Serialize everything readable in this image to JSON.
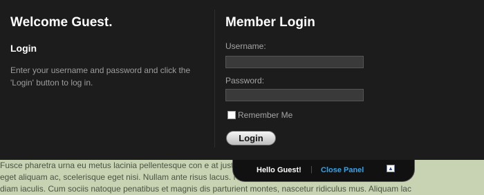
{
  "left": {
    "welcome": "Welcome Guest.",
    "subheading": "Login",
    "description": "Enter your username and password and click the 'Login' button to log in."
  },
  "login": {
    "title": "Member Login",
    "username_label": "Username:",
    "username_value": "",
    "password_label": "Password:",
    "password_value": "",
    "remember_label": "Remember Me",
    "remember_checked": false,
    "button_label": "Login"
  },
  "tab": {
    "greeting": "Hello Guest!",
    "separator": "|",
    "close_label": "Close Panel",
    "toggle_icon": "chevron-up-icon"
  },
  "content": {
    "lines": [
      "Fusce pharetra urna eu metus lacinia pellentesque con                                                  e at justo dictum",
      "eget aliquam ac, scelerisque eget nisi. Nullam ante risus                                              lacus. Nunc pulvin",
      "diam iaculis. Cum sociis natoque penatibus et magnis dis parturient montes, nascetur ridiculus mus. Aliquam lac"
    ]
  },
  "colors": {
    "panel_bg": "#1c1c1c",
    "page_bg": "#c8d3b4",
    "link": "#36a3e8"
  }
}
